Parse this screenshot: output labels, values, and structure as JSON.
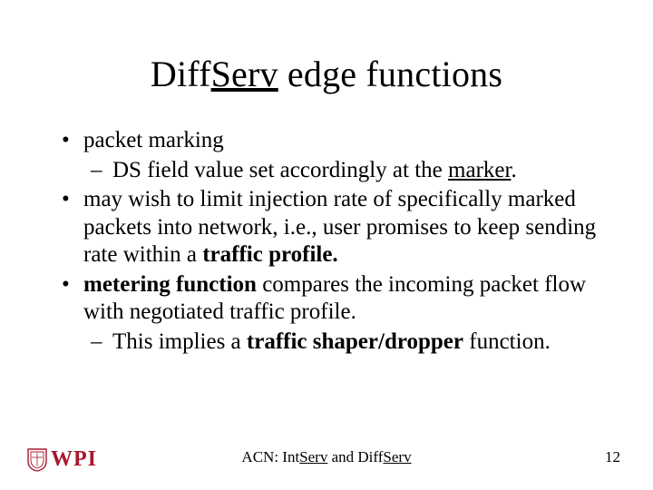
{
  "title": {
    "prefix": "Diff",
    "abbrev": "Serv",
    "suffix": " edge functions"
  },
  "bullets": {
    "b1": "packet marking",
    "b1s1_pre": "DS field value set accordingly at the ",
    "b1s1_u": "marker",
    "b1s1_post": ".",
    "b2_pre": "may wish to limit injection rate of specifically marked packets into network, i.e., user promises to keep sending rate within a ",
    "b2_bold": "traffic profile.",
    "b3_bold": "metering function",
    "b3_post": " compares the incoming packet flow with negotiated traffic profile.",
    "b3s1_pre": "This implies a ",
    "b3s1_bold": "traffic shaper/dropper",
    "b3s1_post": " function."
  },
  "footer": {
    "logo_text": "WPI",
    "center_pre": "ACN: Int",
    "center_u1": "Serv",
    "center_mid": " and Diff",
    "center_u2": "Serv",
    "page": "12"
  },
  "colors": {
    "accent": "#a6192e"
  }
}
